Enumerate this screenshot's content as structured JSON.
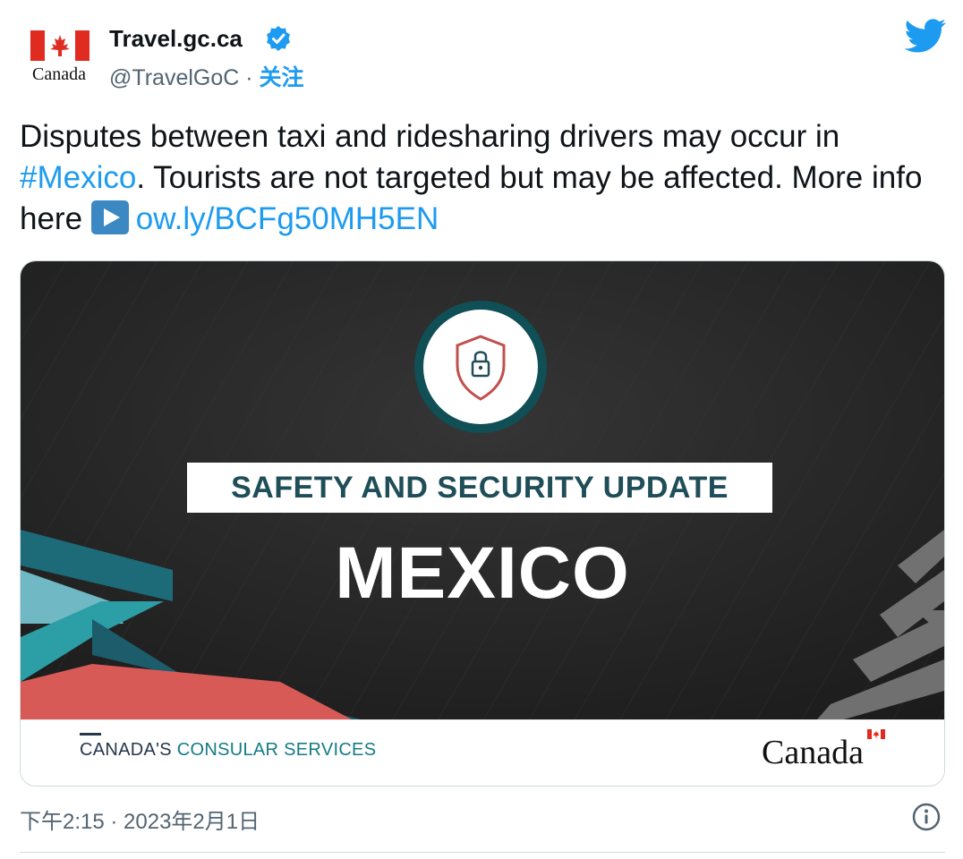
{
  "account": {
    "avatar_text": "Canada",
    "name": "Travel.gc.ca",
    "handle": "@TravelGoC",
    "separator": "·",
    "follow_label": "关注"
  },
  "tweet": {
    "text_part1": "Disputes between taxi and ridesharing drivers may occur in ",
    "hashtag": "#Mexico",
    "text_part2": ". Tourists are not targeted but may be affected. More info here ",
    "link": "ow.ly/BCFg50MH5EN",
    "timestamp": "下午2:15 · 2023年2月1日"
  },
  "card": {
    "banner": "SAFETY AND SECURITY UPDATE",
    "country": "MEXICO",
    "footer_left_part1": "CANADA'S ",
    "footer_left_part2": "CONSULAR SERVICES",
    "footer_right": "Canada"
  },
  "icons": {
    "verified": "verified-badge-icon",
    "twitter": "twitter-bird-icon",
    "play": "play-button-emoji",
    "shield": "shield-lock-icon",
    "info": "info-icon"
  },
  "colors": {
    "accent": "#1d9bf0",
    "canada_red": "#e02b20",
    "teal": "#137b87",
    "card_dark": "#232323"
  }
}
